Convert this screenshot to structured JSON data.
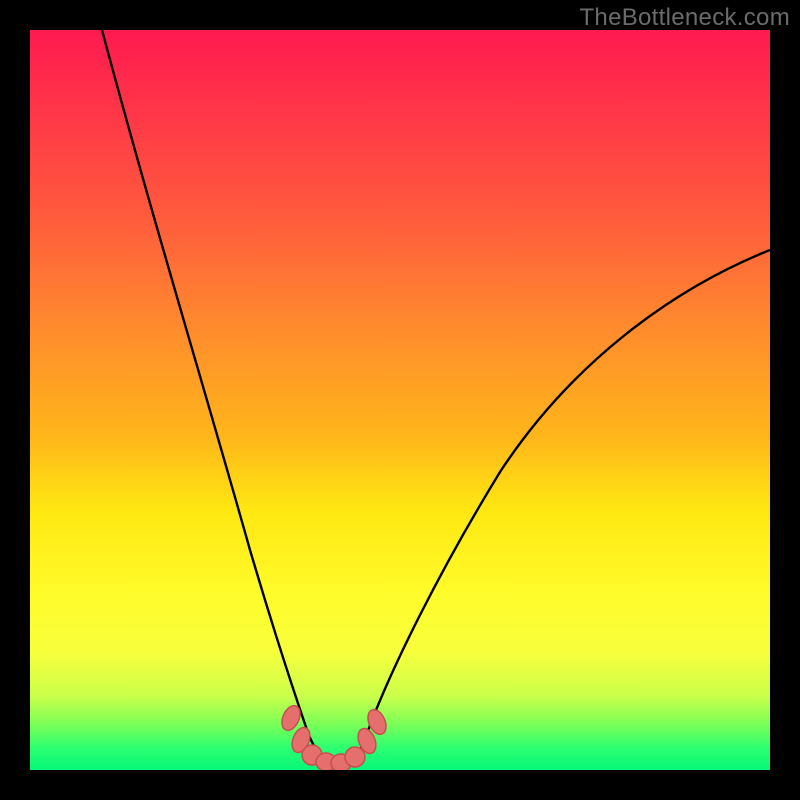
{
  "watermark": "TheBottleneck.com",
  "colors": {
    "frame": "#000000",
    "curve": "#000000",
    "marker_fill": "#e46f6c",
    "marker_stroke": "#c74e4f",
    "gradient_stops": [
      "#ff1a50",
      "#ff2e4a",
      "#ff5a3d",
      "#ff8a2d",
      "#ffb61a",
      "#ffe812",
      "#fffb2a",
      "#f7ff3c",
      "#caff4a",
      "#77ff59",
      "#2dff70",
      "#06f779"
    ]
  },
  "chart_data": {
    "type": "line",
    "title": "",
    "xlabel": "",
    "ylabel": "",
    "xlim": [
      0,
      100
    ],
    "ylim": [
      0,
      100
    ],
    "series": [
      {
        "name": "bottleneck_curve_left",
        "x": [
          10,
          14,
          18,
          22,
          26,
          30,
          33,
          35.5,
          37.5
        ],
        "values": [
          100,
          82,
          65,
          49,
          34,
          21,
          12,
          6,
          3
        ]
      },
      {
        "name": "bottleneck_curve_right",
        "x": [
          45,
          48,
          52,
          58,
          64,
          72,
          80,
          88,
          96,
          100
        ],
        "values": [
          3,
          6,
          10,
          17,
          25,
          36,
          47,
          57,
          66,
          70
        ]
      }
    ],
    "markers": [
      {
        "x": 35,
        "y": 7,
        "shape": "diamond"
      },
      {
        "x": 36.5,
        "y": 4,
        "shape": "diamond"
      },
      {
        "x": 37.5,
        "y": 2,
        "shape": "round"
      },
      {
        "x": 39,
        "y": 1,
        "shape": "round"
      },
      {
        "x": 41.5,
        "y": 1,
        "shape": "round"
      },
      {
        "x": 43.5,
        "y": 1.5,
        "shape": "round"
      },
      {
        "x": 45,
        "y": 3,
        "shape": "diamond"
      },
      {
        "x": 46.5,
        "y": 5,
        "shape": "diamond"
      }
    ]
  }
}
